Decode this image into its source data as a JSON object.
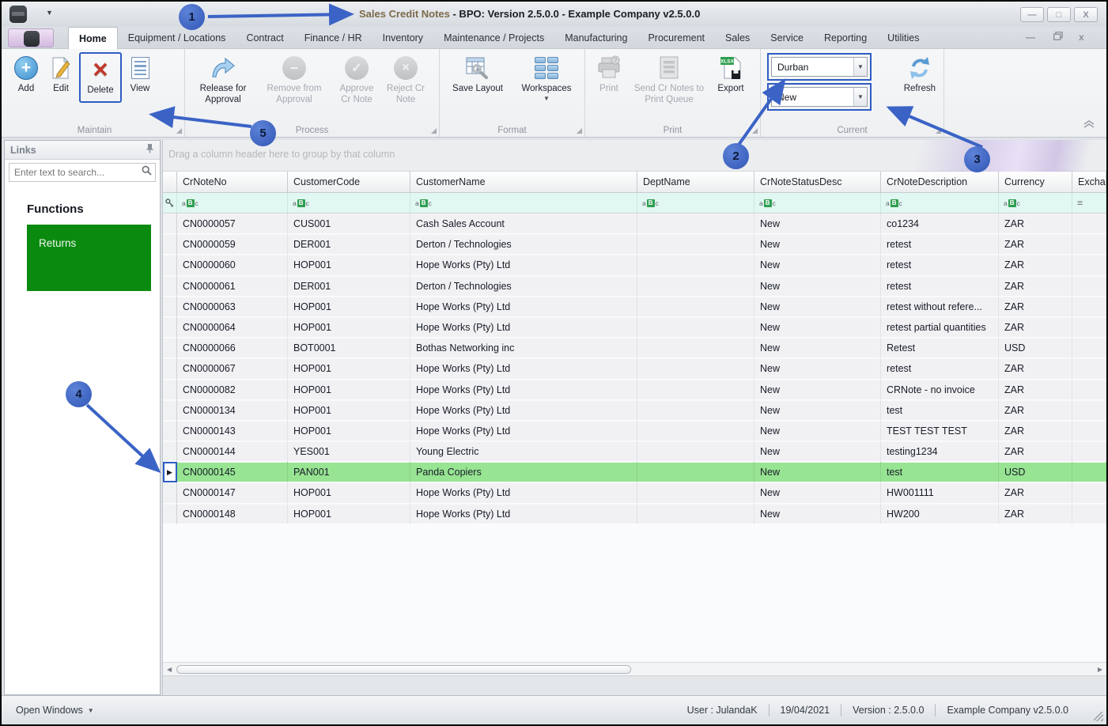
{
  "window": {
    "title_prefix": "Sales Credit Notes",
    "title_rest": " - BPO: Version 2.5.0.0 - Example Company v2.5.0.0"
  },
  "tabs": [
    "Home",
    "Equipment / Locations",
    "Contract",
    "Finance / HR",
    "Inventory",
    "Maintenance / Projects",
    "Manufacturing",
    "Procurement",
    "Sales",
    "Service",
    "Reporting",
    "Utilities"
  ],
  "ribbon": {
    "groups": {
      "maintain": {
        "label": "Maintain",
        "add": "Add",
        "edit": "Edit",
        "delete": "Delete",
        "view": "View"
      },
      "process": {
        "label": "Process",
        "release": "Release for Approval",
        "remove": "Remove from Approval",
        "approve": "Approve Cr Note",
        "reject": "Reject Cr Note"
      },
      "format": {
        "label": "Format",
        "save_layout": "Save Layout",
        "workspaces": "Workspaces"
      },
      "print": {
        "label": "Print",
        "print": "Print",
        "send": "Send Cr Notes to Print Queue",
        "export": "Export",
        "export_badge": "XLSX"
      },
      "current": {
        "label": "Current",
        "site_value": "Durban",
        "status_value": "New",
        "refresh": "Refresh"
      }
    }
  },
  "sidebar": {
    "title": "Links",
    "search_placeholder": "Enter text to search...",
    "functions_heading": "Functions",
    "items": [
      {
        "label": "Returns"
      }
    ]
  },
  "grid": {
    "group_by_hint": "Drag a column header here to group by that column",
    "columns": [
      "CrNoteNo",
      "CustomerCode",
      "CustomerName",
      "DeptName",
      "CrNoteStatusDesc",
      "CrNoteDescription",
      "Currency",
      "Excha"
    ],
    "filter_glyph_parts": [
      "a",
      "B",
      "c"
    ],
    "filter_numeric_glyph": "=",
    "selected_index": 12,
    "rows": [
      [
        "CN0000057",
        "CUS001",
        "Cash Sales Account",
        "",
        "New",
        "co1234",
        "ZAR"
      ],
      [
        "CN0000059",
        "DER001",
        "Derton / Technologies",
        "",
        "New",
        "retest",
        "ZAR"
      ],
      [
        "CN0000060",
        "HOP001",
        "Hope Works (Pty) Ltd",
        "",
        "New",
        "retest",
        "ZAR"
      ],
      [
        "CN0000061",
        "DER001",
        "Derton / Technologies",
        "",
        "New",
        "retest",
        "ZAR"
      ],
      [
        "CN0000063",
        "HOP001",
        "Hope Works (Pty) Ltd",
        "",
        "New",
        "retest without refere...",
        "ZAR"
      ],
      [
        "CN0000064",
        "HOP001",
        "Hope Works (Pty) Ltd",
        "",
        "New",
        "retest partial quantities",
        "ZAR"
      ],
      [
        "CN0000066",
        "BOT0001",
        "Bothas Networking inc",
        "",
        "New",
        "Retest",
        "USD"
      ],
      [
        "CN0000067",
        "HOP001",
        "Hope Works (Pty) Ltd",
        "",
        "New",
        "retest",
        "ZAR"
      ],
      [
        "CN0000082",
        "HOP001",
        "Hope Works (Pty) Ltd",
        "",
        "New",
        "CRNote - no invoice",
        "ZAR"
      ],
      [
        "CN0000134",
        "HOP001",
        "Hope Works (Pty) Ltd",
        "",
        "New",
        "test",
        "ZAR"
      ],
      [
        "CN0000143",
        "HOP001",
        "Hope Works (Pty) Ltd",
        "",
        "New",
        "TEST TEST TEST",
        "ZAR"
      ],
      [
        "CN0000144",
        "YES001",
        "Young Electric",
        "",
        "New",
        "testing1234",
        "ZAR"
      ],
      [
        "CN0000145",
        "PAN001",
        "Panda Copiers",
        "",
        "New",
        "test",
        "USD"
      ],
      [
        "CN0000147",
        "HOP001",
        "Hope Works (Pty) Ltd",
        "",
        "New",
        "HW001111",
        "ZAR"
      ],
      [
        "CN0000148",
        "HOP001",
        "Hope Works (Pty) Ltd",
        "",
        "New",
        "HW200",
        "ZAR"
      ]
    ]
  },
  "statusbar": {
    "open_windows": "Open Windows",
    "user": "User : JulandaK",
    "date": "19/04/2021",
    "version": "Version : 2.5.0.0",
    "company": "Example Company v2.5.0.0"
  },
  "callouts": [
    "1",
    "2",
    "3",
    "4",
    "5"
  ],
  "colors": {
    "callout_blue": "#3b63c6",
    "highlight_border_blue": "#2f5cc4",
    "selected_row_green": "#97e492",
    "returns_tile_green": "#0b8a10",
    "filter_row_aqua": "#e1f7f1"
  }
}
